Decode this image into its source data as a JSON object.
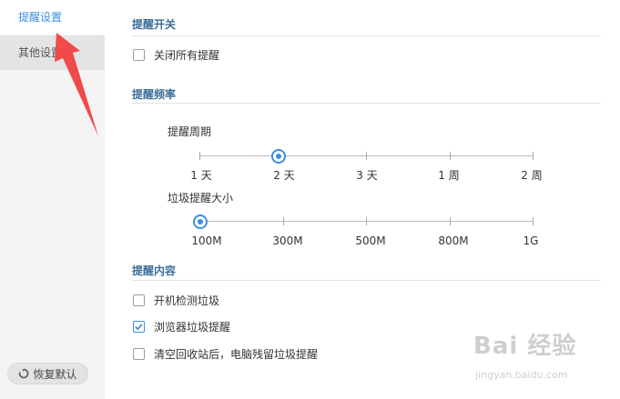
{
  "sidebar": {
    "items": [
      {
        "label": "提醒设置"
      },
      {
        "label": "其他设置"
      }
    ],
    "restore_label": "恢复默认"
  },
  "switch_section": {
    "title": "提醒开关",
    "close_all_label": "关闭所有提醒",
    "close_all_checked": false
  },
  "frequency_section": {
    "title": "提醒频率",
    "period": {
      "label": "提醒周期",
      "ticks": [
        "1 天",
        "2 天",
        "3 天",
        "1 周",
        "2 周"
      ],
      "selected": "2 天"
    },
    "size": {
      "label": "垃圾提醒大小",
      "ticks": [
        "100M",
        "300M",
        "500M",
        "800M",
        "1G"
      ],
      "selected": "100M"
    }
  },
  "content_section": {
    "title": "提醒内容",
    "options": [
      {
        "label": "开机检测垃圾",
        "checked": false
      },
      {
        "label": "浏览器垃圾提醒",
        "checked": true
      },
      {
        "label": "清空回收站后，电脑残留垃圾提醒",
        "checked": false
      }
    ]
  },
  "watermark": {
    "brand": "Bai 经验",
    "url": "jingyan.baidu.com"
  },
  "colors": {
    "accent": "#3d8ee0",
    "section_title": "#3c6e98",
    "arrow": "#f04a4a"
  }
}
